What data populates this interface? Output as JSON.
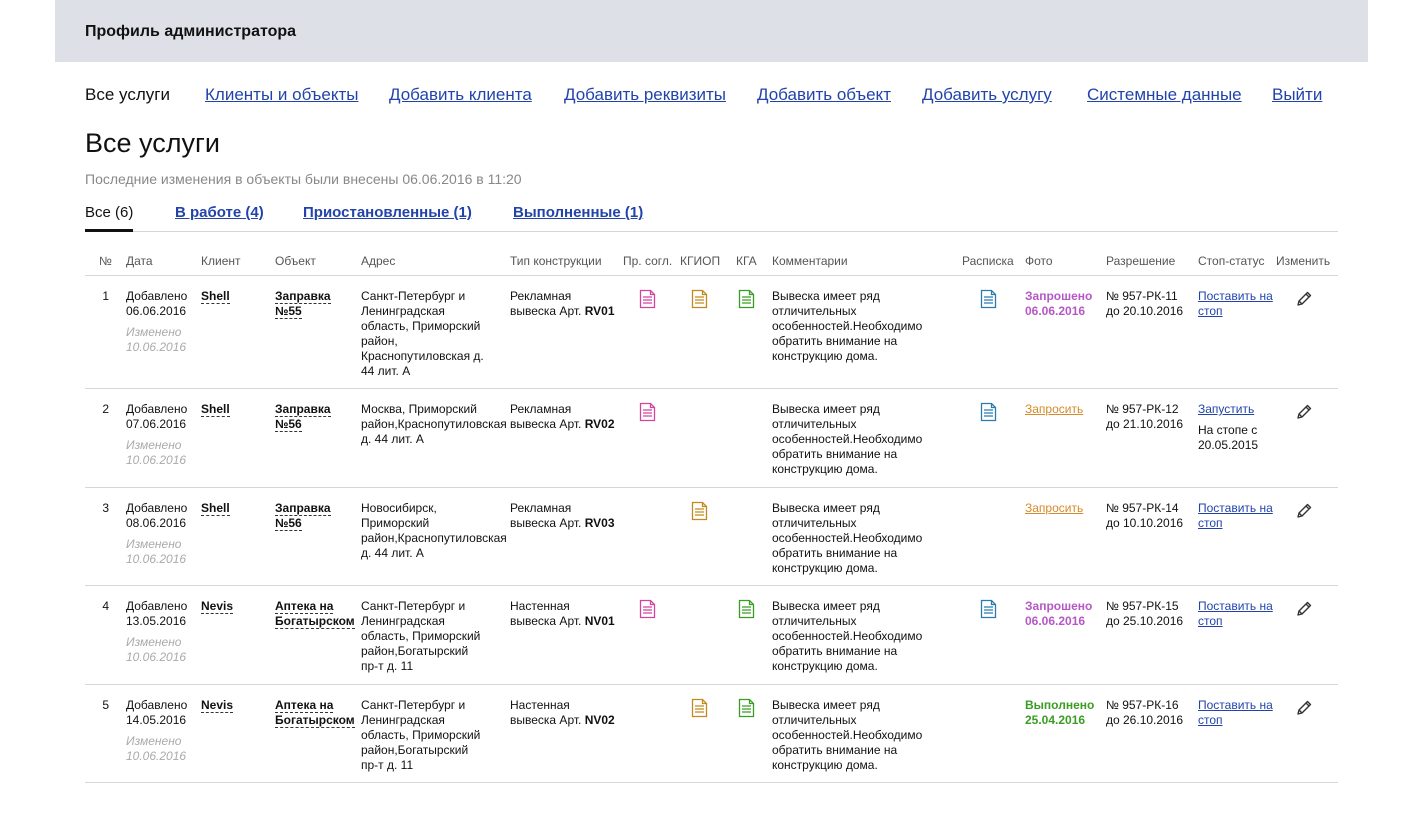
{
  "header": {
    "title": "Профиль администратора"
  },
  "nav": {
    "current": "Все услуги",
    "links": [
      "Клиенты и объекты",
      "Добавить клиента",
      "Добавить реквизиты",
      "Добавить объект",
      "Добавить услугу",
      "Системные данные",
      "Выйти"
    ]
  },
  "page": {
    "title": "Все услуги",
    "last_change": "Последние изменения в объекты были внесены 06.06.2016 в 11:20"
  },
  "tabs": [
    "Все (6)",
    "В работе (4)",
    "Приостановленные (1)",
    "Выполненные (1)"
  ],
  "table": {
    "headers": [
      "№",
      "Дата",
      "Клиент",
      "Объект",
      "Адрес",
      "Тип конструкции",
      "Пр. согл.",
      "КГИОП",
      "КГА",
      "Комментарии",
      "Расписка",
      "Фото",
      "Разрешение",
      "Стоп-статус",
      "Изменить"
    ],
    "colors": {
      "pr": "#d4439e",
      "kgiop": "#c28a1e",
      "kga": "#3a9d23",
      "receipt": "#2b7bb0"
    },
    "rows": [
      {
        "num": "1",
        "added_1": "Добавлено",
        "added_2": "06.06.2016",
        "changed_1": "Изменено",
        "changed_2": "10.06.2016",
        "client": "Shell",
        "object_1": "Заправка",
        "object_2": "№55",
        "address": [
          "Санкт-Петербург и",
          "Ленинградская",
          "область, Приморский",
          "район,",
          "Краснопутиловская д.",
          "44 лит. А"
        ],
        "type_1": "Рекламная",
        "type_2": "вывеска Арт. ",
        "type_code": "RV01",
        "comment": [
          "Вывеска имеет ряд",
          "отличительных",
          "особенностей.Необходимо",
          "обратить внимание на",
          "конструкцию дома."
        ],
        "photo_1": "Запрошено",
        "photo_2": "06.06.2016",
        "permit_1": "№ 957-РК-11",
        "permit_2": "до 20.10.2016",
        "stop_1": "Поставить на",
        "stop_2": "стоп"
      },
      {
        "num": "2",
        "added_1": "Добавлено",
        "added_2": "07.06.2016",
        "changed_1": "Изменено",
        "changed_2": "10.06.2016",
        "client": "Shell",
        "object_1": "Заправка",
        "object_2": "№56",
        "address": [
          "Москва, Приморский",
          "район,Краснопутиловская",
          "д. 44 лит. А"
        ],
        "type_1": "Рекламная",
        "type_2": "вывеска Арт. ",
        "type_code": "RV02",
        "comment": [
          "Вывеска имеет ряд",
          "отличительных",
          "особенностей.Необходимо",
          "обратить внимание на",
          "конструкцию дома."
        ],
        "photo_ask": "Запросить",
        "permit_1": "№ 957-РК-12",
        "permit_2": "до 21.10.2016",
        "stop_run": "Запустить",
        "stop_note_1": "На стопе с",
        "stop_note_2": "20.05.2015"
      },
      {
        "num": "3",
        "added_1": "Добавлено",
        "added_2": "08.06.2016",
        "changed_1": "Изменено",
        "changed_2": "10.06.2016",
        "client": "Shell",
        "object_1": "Заправка",
        "object_2": "№56",
        "address": [
          "Новосибирск,",
          "Приморский",
          "район,Краснопутиловская",
          "д. 44 лит. А"
        ],
        "type_1": "Рекламная",
        "type_2": "вывеска Арт. ",
        "type_code": "RV03",
        "comment": [
          "Вывеска имеет ряд",
          "отличительных",
          "особенностей.Необходимо",
          "обратить внимание на",
          "конструкцию дома."
        ],
        "photo_ask": "Запросить",
        "permit_1": "№ 957-РК-14",
        "permit_2": "до 10.10.2016",
        "stop_1": "Поставить на",
        "stop_2": "стоп"
      },
      {
        "num": "4",
        "added_1": "Добавлено",
        "added_2": "13.05.2016",
        "changed_1": "Изменено",
        "changed_2": "10.06.2016",
        "client": "Nevis",
        "object_1": "Аптека на",
        "object_2": "Богатырском",
        "address": [
          "Санкт-Петербург и",
          "Ленинградская",
          "область, Приморский",
          "район,Богатырский",
          "пр-т д. 11"
        ],
        "type_1": "Настенная",
        "type_2": "вывеска Арт. ",
        "type_code": "NV01",
        "comment": [
          "Вывеска имеет ряд",
          "отличительных",
          "особенностей.Необходимо",
          "обратить внимание на",
          "конструкцию дома."
        ],
        "photo_1": "Запрошено",
        "photo_2": "06.06.2016",
        "permit_1": "№ 957-РК-15",
        "permit_2": "до 25.10.2016",
        "stop_1": "Поставить на",
        "stop_2": "стоп"
      },
      {
        "num": "5",
        "added_1": "Добавлено",
        "added_2": "14.05.2016",
        "changed_1": "Изменено",
        "changed_2": "10.06.2016",
        "client": "Nevis",
        "object_1": "Аптека на",
        "object_2": "Богатырском",
        "address": [
          "Санкт-Петербург и",
          "Ленинградская",
          "область, Приморский",
          "район,Богатырский",
          "пр-т д. 11"
        ],
        "type_1": "Настенная",
        "type_2": "вывеска Арт. ",
        "type_code": "NV02",
        "comment": [
          "Вывеска имеет ряд",
          "отличительных",
          "особенностей.Необходимо",
          "обратить внимание на",
          "конструкцию дома."
        ],
        "photo_done_1": "Выполнено",
        "photo_done_2": "25.04.2016",
        "permit_1": "№ 957-РК-16",
        "permit_2": "до 26.10.2016",
        "stop_1": "Поставить на",
        "stop_2": "стоп"
      }
    ]
  }
}
